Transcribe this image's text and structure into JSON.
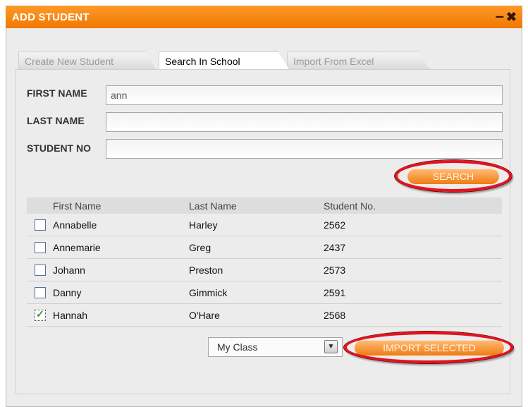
{
  "window": {
    "title": "ADD STUDENT",
    "minimize_icon": "minimize-icon",
    "close_icon": "close-icon",
    "minimize_glyph": "–",
    "close_glyph": "✖"
  },
  "tabs": [
    {
      "label": "Create New Student",
      "active": false
    },
    {
      "label": "Search In School",
      "active": true
    },
    {
      "label": "Import From Excel",
      "active": false
    }
  ],
  "form": {
    "first_name": {
      "label": "FIRST NAME",
      "value": "ann"
    },
    "last_name": {
      "label": "LAST NAME",
      "value": ""
    },
    "student_no": {
      "label": "STUDENT NO",
      "value": ""
    }
  },
  "search_button": {
    "label": "SEARCH"
  },
  "table": {
    "headers": [
      "First Name",
      "Last Name",
      "Student No."
    ],
    "rows": [
      {
        "first": "Annabelle",
        "last": "Harley",
        "no": "2562",
        "checked": false
      },
      {
        "first": "Annemarie",
        "last": "Greg",
        "no": "2437",
        "checked": false
      },
      {
        "first": "Johann",
        "last": "Preston",
        "no": "2573",
        "checked": false
      },
      {
        "first": "Danny",
        "last": "Gimmick",
        "no": "2591",
        "checked": false
      },
      {
        "first": "Hannah",
        "last": "O'Hare",
        "no": "2568",
        "checked": true
      }
    ]
  },
  "class_select": {
    "selected": "My Class",
    "arrow_icon": "chevron-down-icon",
    "arrow_glyph": "▼"
  },
  "import_button": {
    "label": "IMPORT SELECTED"
  },
  "check_glyph": "✓",
  "colors": {
    "accent": "#f07800",
    "highlight_ring": "#e3121f",
    "check": "#2d9b1c"
  }
}
